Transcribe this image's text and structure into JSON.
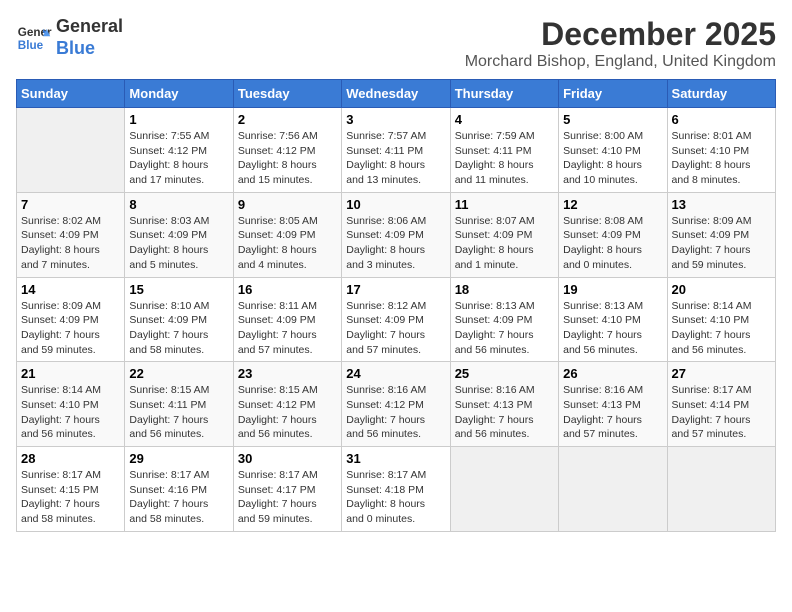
{
  "header": {
    "logo_line1": "General",
    "logo_line2": "Blue",
    "month": "December 2025",
    "location": "Morchard Bishop, England, United Kingdom"
  },
  "days_of_week": [
    "Sunday",
    "Monday",
    "Tuesday",
    "Wednesday",
    "Thursday",
    "Friday",
    "Saturday"
  ],
  "weeks": [
    [
      {
        "day": "",
        "info": ""
      },
      {
        "day": "1",
        "info": "Sunrise: 7:55 AM\nSunset: 4:12 PM\nDaylight: 8 hours\nand 17 minutes."
      },
      {
        "day": "2",
        "info": "Sunrise: 7:56 AM\nSunset: 4:12 PM\nDaylight: 8 hours\nand 15 minutes."
      },
      {
        "day": "3",
        "info": "Sunrise: 7:57 AM\nSunset: 4:11 PM\nDaylight: 8 hours\nand 13 minutes."
      },
      {
        "day": "4",
        "info": "Sunrise: 7:59 AM\nSunset: 4:11 PM\nDaylight: 8 hours\nand 11 minutes."
      },
      {
        "day": "5",
        "info": "Sunrise: 8:00 AM\nSunset: 4:10 PM\nDaylight: 8 hours\nand 10 minutes."
      },
      {
        "day": "6",
        "info": "Sunrise: 8:01 AM\nSunset: 4:10 PM\nDaylight: 8 hours\nand 8 minutes."
      }
    ],
    [
      {
        "day": "7",
        "info": "Sunrise: 8:02 AM\nSunset: 4:09 PM\nDaylight: 8 hours\nand 7 minutes."
      },
      {
        "day": "8",
        "info": "Sunrise: 8:03 AM\nSunset: 4:09 PM\nDaylight: 8 hours\nand 5 minutes."
      },
      {
        "day": "9",
        "info": "Sunrise: 8:05 AM\nSunset: 4:09 PM\nDaylight: 8 hours\nand 4 minutes."
      },
      {
        "day": "10",
        "info": "Sunrise: 8:06 AM\nSunset: 4:09 PM\nDaylight: 8 hours\nand 3 minutes."
      },
      {
        "day": "11",
        "info": "Sunrise: 8:07 AM\nSunset: 4:09 PM\nDaylight: 8 hours\nand 1 minute."
      },
      {
        "day": "12",
        "info": "Sunrise: 8:08 AM\nSunset: 4:09 PM\nDaylight: 8 hours\nand 0 minutes."
      },
      {
        "day": "13",
        "info": "Sunrise: 8:09 AM\nSunset: 4:09 PM\nDaylight: 7 hours\nand 59 minutes."
      }
    ],
    [
      {
        "day": "14",
        "info": "Sunrise: 8:09 AM\nSunset: 4:09 PM\nDaylight: 7 hours\nand 59 minutes."
      },
      {
        "day": "15",
        "info": "Sunrise: 8:10 AM\nSunset: 4:09 PM\nDaylight: 7 hours\nand 58 minutes."
      },
      {
        "day": "16",
        "info": "Sunrise: 8:11 AM\nSunset: 4:09 PM\nDaylight: 7 hours\nand 57 minutes."
      },
      {
        "day": "17",
        "info": "Sunrise: 8:12 AM\nSunset: 4:09 PM\nDaylight: 7 hours\nand 57 minutes."
      },
      {
        "day": "18",
        "info": "Sunrise: 8:13 AM\nSunset: 4:09 PM\nDaylight: 7 hours\nand 56 minutes."
      },
      {
        "day": "19",
        "info": "Sunrise: 8:13 AM\nSunset: 4:10 PM\nDaylight: 7 hours\nand 56 minutes."
      },
      {
        "day": "20",
        "info": "Sunrise: 8:14 AM\nSunset: 4:10 PM\nDaylight: 7 hours\nand 56 minutes."
      }
    ],
    [
      {
        "day": "21",
        "info": "Sunrise: 8:14 AM\nSunset: 4:10 PM\nDaylight: 7 hours\nand 56 minutes."
      },
      {
        "day": "22",
        "info": "Sunrise: 8:15 AM\nSunset: 4:11 PM\nDaylight: 7 hours\nand 56 minutes."
      },
      {
        "day": "23",
        "info": "Sunrise: 8:15 AM\nSunset: 4:12 PM\nDaylight: 7 hours\nand 56 minutes."
      },
      {
        "day": "24",
        "info": "Sunrise: 8:16 AM\nSunset: 4:12 PM\nDaylight: 7 hours\nand 56 minutes."
      },
      {
        "day": "25",
        "info": "Sunrise: 8:16 AM\nSunset: 4:13 PM\nDaylight: 7 hours\nand 56 minutes."
      },
      {
        "day": "26",
        "info": "Sunrise: 8:16 AM\nSunset: 4:13 PM\nDaylight: 7 hours\nand 57 minutes."
      },
      {
        "day": "27",
        "info": "Sunrise: 8:17 AM\nSunset: 4:14 PM\nDaylight: 7 hours\nand 57 minutes."
      }
    ],
    [
      {
        "day": "28",
        "info": "Sunrise: 8:17 AM\nSunset: 4:15 PM\nDaylight: 7 hours\nand 58 minutes."
      },
      {
        "day": "29",
        "info": "Sunrise: 8:17 AM\nSunset: 4:16 PM\nDaylight: 7 hours\nand 58 minutes."
      },
      {
        "day": "30",
        "info": "Sunrise: 8:17 AM\nSunset: 4:17 PM\nDaylight: 7 hours\nand 59 minutes."
      },
      {
        "day": "31",
        "info": "Sunrise: 8:17 AM\nSunset: 4:18 PM\nDaylight: 8 hours\nand 0 minutes."
      },
      {
        "day": "",
        "info": ""
      },
      {
        "day": "",
        "info": ""
      },
      {
        "day": "",
        "info": ""
      }
    ]
  ]
}
